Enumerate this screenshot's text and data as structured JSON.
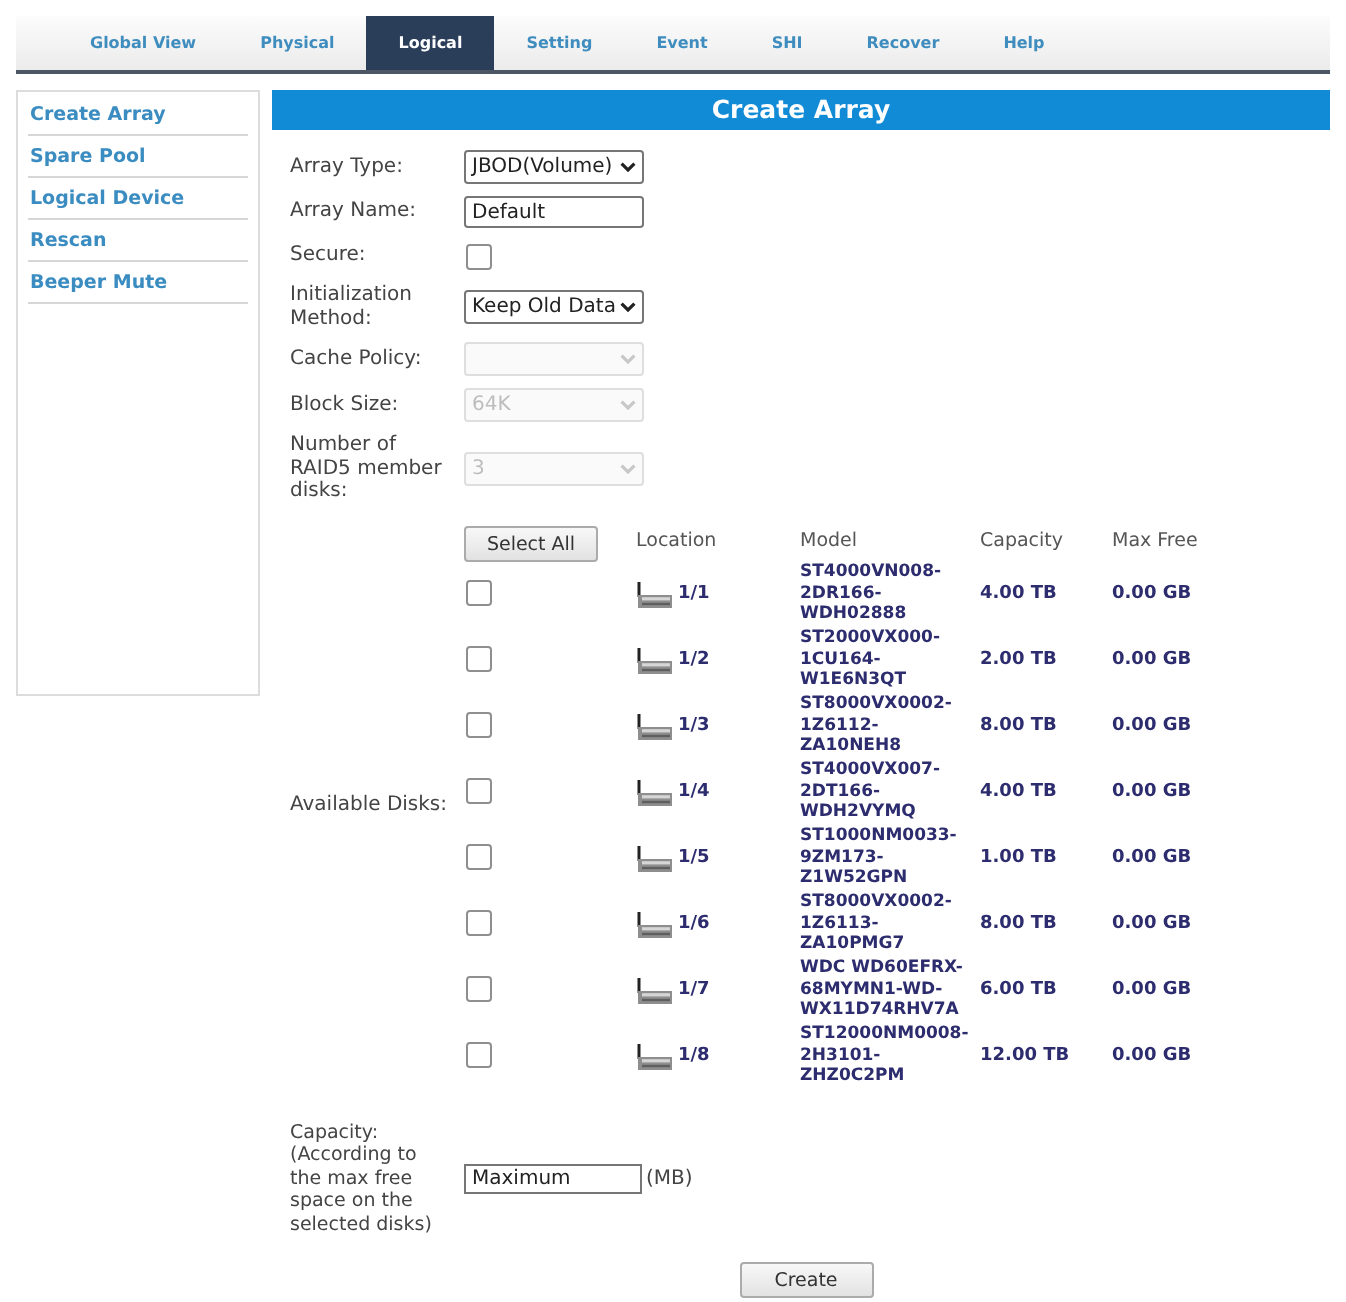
{
  "nav_tabs": [
    {
      "label": "Global View",
      "selected": false
    },
    {
      "label": "Physical",
      "selected": false
    },
    {
      "label": "Logical",
      "selected": true
    },
    {
      "label": "Setting",
      "selected": false
    },
    {
      "label": "Event",
      "selected": false
    },
    {
      "label": "SHI",
      "selected": false
    },
    {
      "label": "Recover",
      "selected": false
    },
    {
      "label": "Help",
      "selected": false
    }
  ],
  "sidebar": {
    "items": [
      "Create Array",
      "Spare Pool",
      "Logical Device",
      "Rescan",
      "Beeper Mute"
    ]
  },
  "panel": {
    "title": "Create Array",
    "fields": [
      {
        "kind": "select",
        "label": "Array Type:",
        "value": "JBOD(Volume)",
        "disabled": false
      },
      {
        "kind": "text",
        "label": "Array Name:",
        "value": "Default"
      },
      {
        "kind": "checkbox",
        "label": "Secure:",
        "checked": false
      },
      {
        "kind": "select",
        "label": "Initialization Method:",
        "value": "Keep Old Data",
        "disabled": false
      },
      {
        "kind": "select",
        "label": "Cache Policy:",
        "disabled": true
      },
      {
        "kind": "select",
        "label": "Block Size:",
        "value": "64K",
        "disabled": true
      },
      {
        "kind": "select",
        "label": "Number of RAID5 member disks:",
        "value": "3",
        "disabled": true
      }
    ],
    "disks": {
      "label": "Available Disks:",
      "select_all": "Select All",
      "columns": [
        "Location",
        "Model",
        "Capacity",
        "Max Free"
      ],
      "rows": [
        {
          "checked": false,
          "location": "1/1",
          "model": [
            "ST4000VN008-",
            "2DR166-",
            "WDH02888"
          ],
          "capacity": "4.00 TB",
          "max_free": "0.00 GB"
        },
        {
          "checked": false,
          "location": "1/2",
          "model": [
            "ST2000VX000-",
            "1CU164-",
            "W1E6N3QT"
          ],
          "capacity": "2.00 TB",
          "max_free": "0.00 GB"
        },
        {
          "checked": false,
          "location": "1/3",
          "model": [
            "ST8000VX0002-",
            "1Z6112-",
            "ZA10NEH8"
          ],
          "capacity": "8.00 TB",
          "max_free": "0.00 GB"
        },
        {
          "checked": false,
          "location": "1/4",
          "model": [
            "ST4000VX007-",
            "2DT166-",
            "WDH2VYMQ"
          ],
          "capacity": "4.00 TB",
          "max_free": "0.00 GB"
        },
        {
          "checked": false,
          "location": "1/5",
          "model": [
            "ST1000NM0033-",
            "9ZM173-",
            "Z1W52GPN"
          ],
          "capacity": "1.00 TB",
          "max_free": "0.00 GB"
        },
        {
          "checked": false,
          "location": "1/6",
          "model": [
            "ST8000VX0002-",
            "1Z6113-",
            "ZA10PMG7"
          ],
          "capacity": "8.00 TB",
          "max_free": "0.00 GB"
        },
        {
          "checked": false,
          "location": "1/7",
          "model": [
            "WDC WD60EFRX-",
            "68MYMN1-WD-",
            "WX11D74RHV7A"
          ],
          "capacity": "6.00 TB",
          "max_free": "0.00 GB"
        },
        {
          "checked": false,
          "location": "1/8",
          "model": [
            "ST12000NM0008-",
            "2H3101-",
            "ZHZ0C2PM"
          ],
          "capacity": "12.00 TB",
          "max_free": "0.00 GB"
        }
      ]
    },
    "capacity": {
      "label": "Capacity: (According to the max free space on the selected disks)",
      "value": "Maximum",
      "unit": "(MB)"
    },
    "create_button": "Create"
  }
}
